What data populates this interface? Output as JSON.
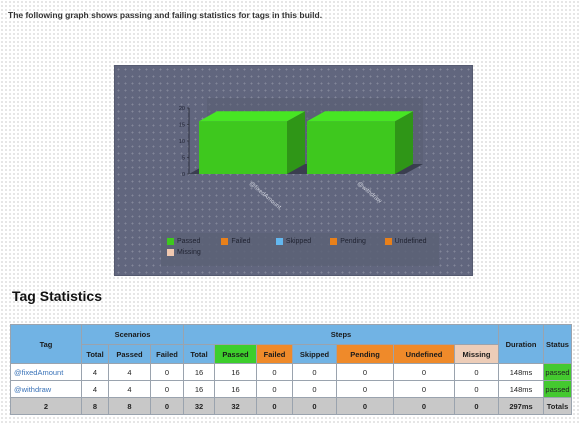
{
  "intro_text": "The following graph shows passing and failing statistics for tags in this build.",
  "chart_data": {
    "type": "bar",
    "categories": [
      "@fixedAmount",
      "@withdraw"
    ],
    "series": [
      {
        "name": "Passed",
        "values": [
          16,
          16
        ],
        "color": "#3ec81e"
      },
      {
        "name": "Failed",
        "values": [
          0,
          0
        ],
        "color": "#e8801a"
      },
      {
        "name": "Skipped",
        "values": [
          0,
          0
        ],
        "color": "#63b8f0"
      },
      {
        "name": "Pending",
        "values": [
          0,
          0
        ],
        "color": "#e8801a"
      },
      {
        "name": "Undefined",
        "values": [
          0,
          0
        ],
        "color": "#e8801a"
      },
      {
        "name": "Missing",
        "values": [
          0,
          0
        ],
        "color": "#f0c8b0"
      }
    ],
    "ylim": [
      0,
      20
    ],
    "yticks": [
      "0",
      "5",
      "10",
      "15",
      "20"
    ],
    "legend_position": "bottom",
    "style": "3d-stacked"
  },
  "section_title": "Tag Statistics",
  "table": {
    "group_headers": {
      "scenarios": "Scenarios",
      "steps": "Steps"
    },
    "columns": {
      "tag": "Tag",
      "sc_total": "Total",
      "sc_passed": "Passed",
      "sc_failed": "Failed",
      "st_total": "Total",
      "st_passed": "Passed",
      "st_failed": "Failed",
      "st_skipped": "Skipped",
      "st_pending": "Pending",
      "st_undefined": "Undefined",
      "st_missing": "Missing",
      "duration": "Duration",
      "status": "Status"
    },
    "rows": [
      {
        "tag": "@fixedAmount",
        "sc_total": "4",
        "sc_passed": "4",
        "sc_failed": "0",
        "st_total": "16",
        "st_passed": "16",
        "st_failed": "0",
        "st_skipped": "0",
        "st_pending": "0",
        "st_undefined": "0",
        "st_missing": "0",
        "duration": "148ms",
        "status": "passed"
      },
      {
        "tag": "@withdraw",
        "sc_total": "4",
        "sc_passed": "4",
        "sc_failed": "0",
        "st_total": "16",
        "st_passed": "16",
        "st_failed": "0",
        "st_skipped": "0",
        "st_pending": "0",
        "st_undefined": "0",
        "st_missing": "0",
        "duration": "148ms",
        "status": "passed"
      }
    ],
    "totals": {
      "tag": "2",
      "sc_total": "8",
      "sc_passed": "8",
      "sc_failed": "0",
      "st_total": "32",
      "st_passed": "32",
      "st_failed": "0",
      "st_skipped": "0",
      "st_pending": "0",
      "st_undefined": "0",
      "st_missing": "0",
      "duration": "297ms",
      "status": "Totals"
    }
  }
}
